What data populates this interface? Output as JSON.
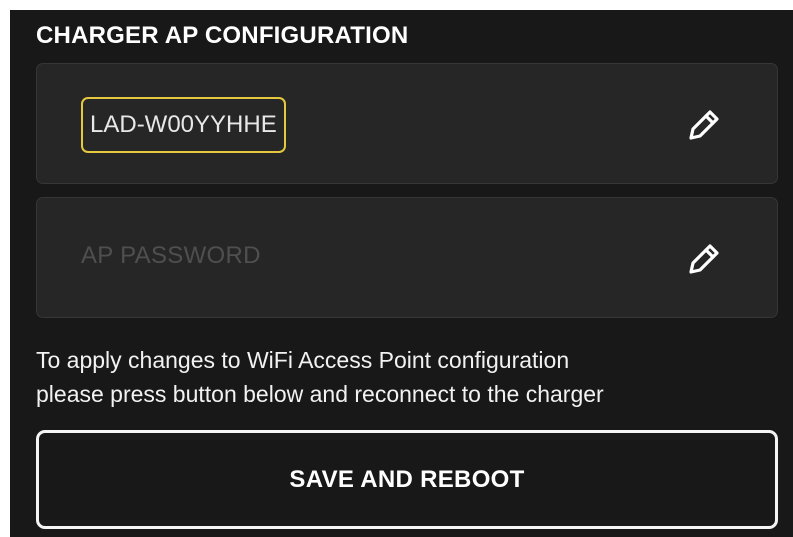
{
  "section": {
    "title": "CHARGER AP CONFIGURATION"
  },
  "ssid_field": {
    "value": "LAD-W00YYHHE",
    "edit_icon": "pencil-icon"
  },
  "password_field": {
    "placeholder": "AP PASSWORD",
    "edit_icon": "pencil-icon"
  },
  "help": {
    "line1": "To apply changes to WiFi Access Point configuration",
    "line2": "please press button below and reconnect to the charger"
  },
  "save_button": {
    "label": "SAVE AND REBOOT"
  },
  "colors": {
    "background": "#181818",
    "card": "#262626",
    "focus_outline": "#e5c740",
    "text": "#ffffff",
    "placeholder": "#4f4f4f"
  }
}
